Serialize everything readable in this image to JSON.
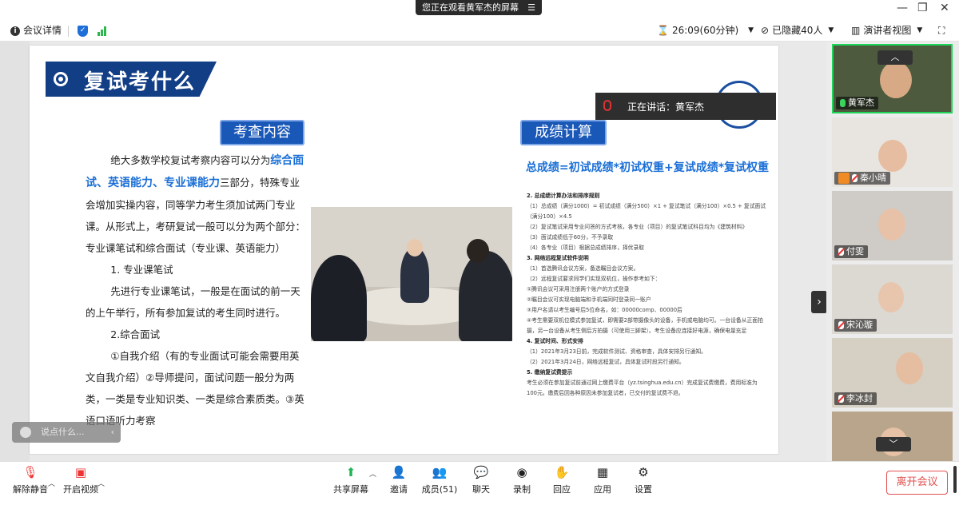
{
  "titlebar": {
    "watching_label": "您正在观看黄军杰的屏幕",
    "menu_glyph": "☰"
  },
  "infobar": {
    "meeting_details": "会议详情",
    "timer": "26:09(60分钟)",
    "hidden_count": "已隐藏40人",
    "view_mode": "演讲者视图"
  },
  "slide": {
    "title": "复试考什么",
    "left_tag": "考查内容",
    "right_tag": "成绩计算",
    "left_text": {
      "p1_a": "绝大多数学校复试考察内容可以分为",
      "p1_hl": "综合面试、英语能力、专业课能力",
      "p1_b": "三部分，特殊专业会增加实操内容，同等学力考生须加试两门专业课。从形式上，考研复试一般可以分为两个部分：专业课笔试和综合面试（专业课、英语能力）",
      "s1": "1. 专业课笔试",
      "s1_body": "先进行专业课笔试，一般是在面试的前一天的上午举行，所有参加复试的考生同时进行。",
      "s2": "2.综合面试",
      "s2_body": "①自我介绍（有的专业面试可能会需要用英文自我介绍）②导师提问，面试问题一般分为两类，一类是专业知识类、一类是综合素质类。③英语口语听力考察"
    },
    "formula": "总成绩=初试成绩*初试权重+复试成绩*复试权重",
    "rules": [
      {
        "h": "2. 总成绩计算办法和排序规则"
      },
      {
        "t": "（1）总成绩（满分1000）= 初试成绩（满分500）×1 + 复试笔试（满分100）×0.5 + 复试面试（满分100）×4.5"
      },
      {
        "t": "（2）复试笔试采用专业问答的方式考核，各专业（项目）的复试笔试科目均为《建筑材料》"
      },
      {
        "t": "（3）面试成绩低于60分，不予录取"
      },
      {
        "t": "（4）各专业（项目）根据总成绩排序，择优录取"
      },
      {
        "h": "3. 网络远程复试软件说明"
      },
      {
        "t": "（1）首选腾讯会议方案，备选瞩目会议方案。"
      },
      {
        "t": "（2）远程复试要求同学们实现双机位，操作参考如下："
      },
      {
        "t": "①腾讯会议可采用注册两个账户的方式登录"
      },
      {
        "t": "②瞩目会议可实现电脑端和手机端同时登录同一账户"
      },
      {
        "t": "③用户名请以考生编号后5位命名，如：00000comp、00000后"
      },
      {
        "t": "④考生需要双机位模式参加复试，即需要2部带摄像头的设备，手机或电脑均可。一台设备从正面拍摄，另一台设备从考生侧后方拍摄（可使用三脚架）。考生设备应连接好电源，确保电量充足"
      },
      {
        "h": "4. 复试时间、形式安排"
      },
      {
        "t": "（1）2021年3月23日前，完成软件测试、资格审查，具体安排另行通知。"
      },
      {
        "t": "（2）2021年3月24日，网络远程复试，具体复试时段另行通知。"
      },
      {
        "h": "5. 缴纳复试费提示"
      },
      {
        "t": "考生必须在参加复试前通过网上缴费平台（yz.tsinghua.edu.cn）完成复试费缴费，费用标准为100元。缴费后因各种原因未参加复试者，已交付的复试费不退。"
      }
    ]
  },
  "speaking": {
    "label": "正在讲话：黄军杰"
  },
  "chat": {
    "placeholder": "说点什么..."
  },
  "participants": [
    {
      "name": "黄军杰"
    },
    {
      "name": "秦小晴"
    },
    {
      "name": "付雯"
    },
    {
      "name": "宋沁璇"
    },
    {
      "name": "李冰封"
    }
  ],
  "toolbar": {
    "mute": "解除静音",
    "video": "开启视频",
    "share": "共享屏幕",
    "invite": "邀请",
    "members": "成员(51)",
    "chat": "聊天",
    "record": "录制",
    "react": "回应",
    "apps": "应用",
    "settings": "设置",
    "leave": "离开会议"
  },
  "colors": {
    "accent": "#1a58b8",
    "speaker_border": "#1fd65a",
    "leave": "#e25050"
  }
}
